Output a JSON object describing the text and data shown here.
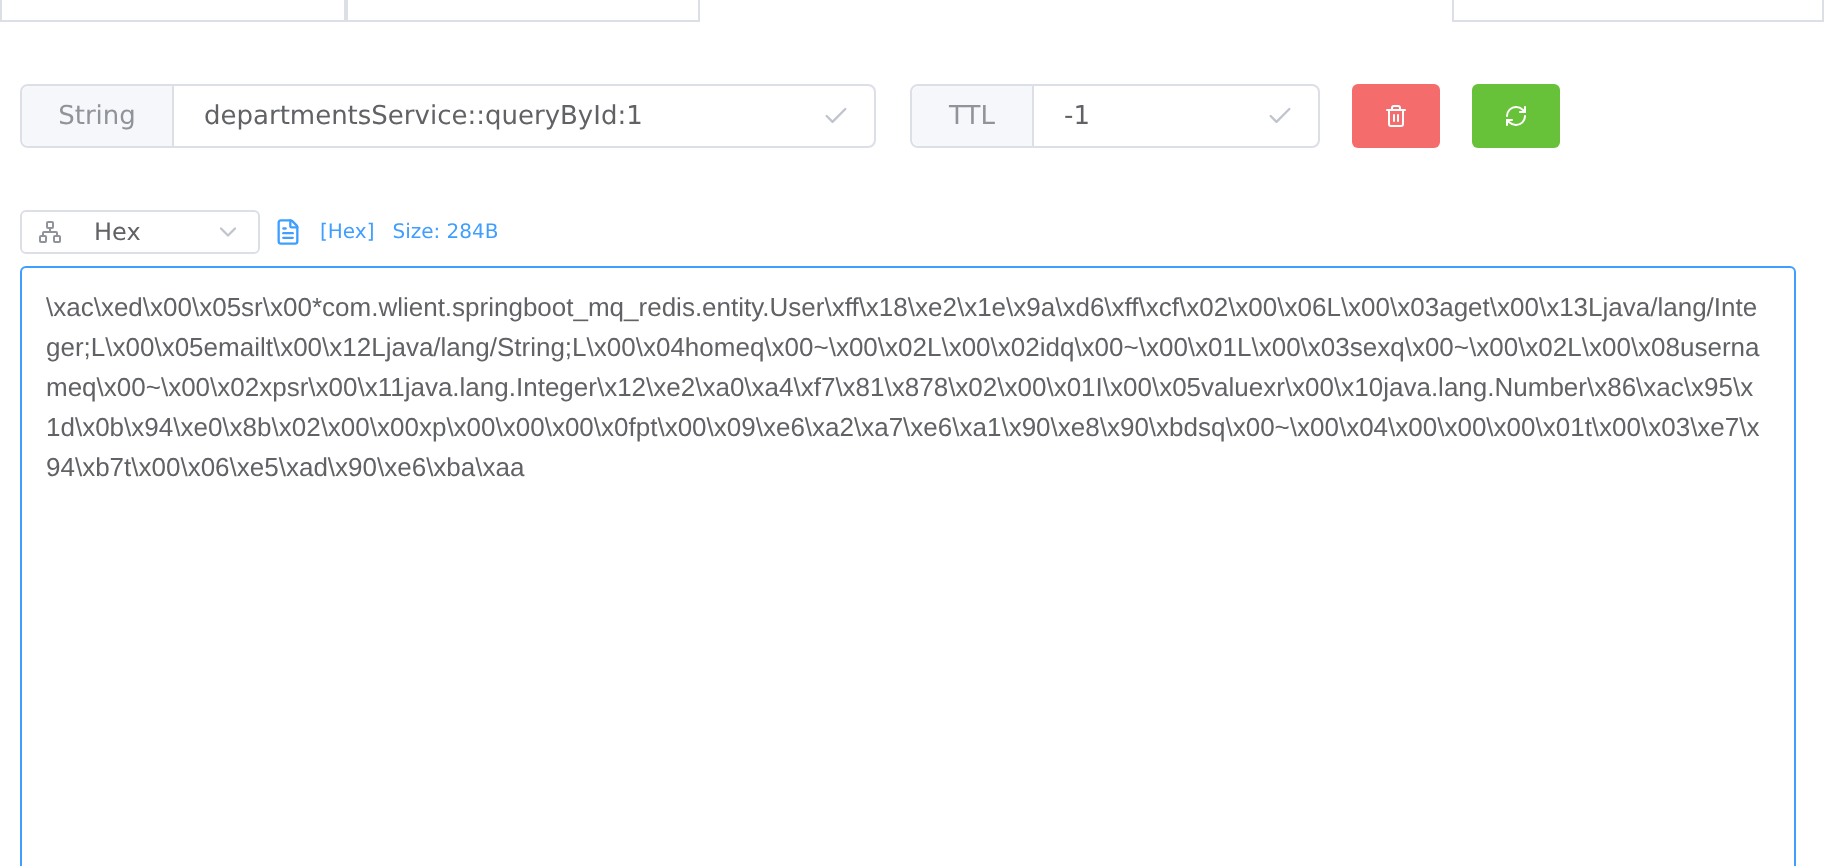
{
  "key_bar": {
    "type_label": "String",
    "key_value": "departmentsService::queryById:1",
    "ttl_label": "TTL",
    "ttl_value": "-1"
  },
  "actions": [
    {
      "kind": "delete"
    },
    {
      "kind": "refresh"
    }
  ],
  "format": {
    "selected": "Hex",
    "format_tag": "[Hex]",
    "size": "Size: 284B"
  },
  "value_text": "\\xac\\xed\\x00\\x05sr\\x00*com.wlient.springboot_mq_redis.entity.User\\xff\\x18\\xe2\\x1e\\x9a\\xd6\\xff\\xcf\\x02\\x00\\x06L\\x00\\x03aget\\x00\\x13Ljava/lang/Integer;L\\x00\\x05emailt\\x00\\x12Ljava/lang/String;L\\x00\\x04homeq\\x00~\\x00\\x02L\\x00\\x02idq\\x00~\\x00\\x01L\\x00\\x03sexq\\x00~\\x00\\x02L\\x00\\x08usernameq\\x00~\\x00\\x02xpsr\\x00\\x11java.lang.Integer\\x12\\xe2\\xa0\\xa4\\xf7\\x81\\x878\\x02\\x00\\x01I\\x00\\x05valuexr\\x00\\x10java.lang.Number\\x86\\xac\\x95\\x1d\\x0b\\x94\\xe0\\x8b\\x02\\x00\\x00xp\\x00\\x00\\x00\\x0fpt\\x00\\x09\\xe6\\xa2\\xa7\\xe6\\xa1\\x90\\xe8\\x90\\xbdsq\\x00~\\x00\\x04\\x00\\x00\\x00\\x01t\\x00\\x03\\xe7\\x94\\xb7t\\x00\\x06\\xe5\\xad\\x90\\xe6\\xba\\xaa"
}
